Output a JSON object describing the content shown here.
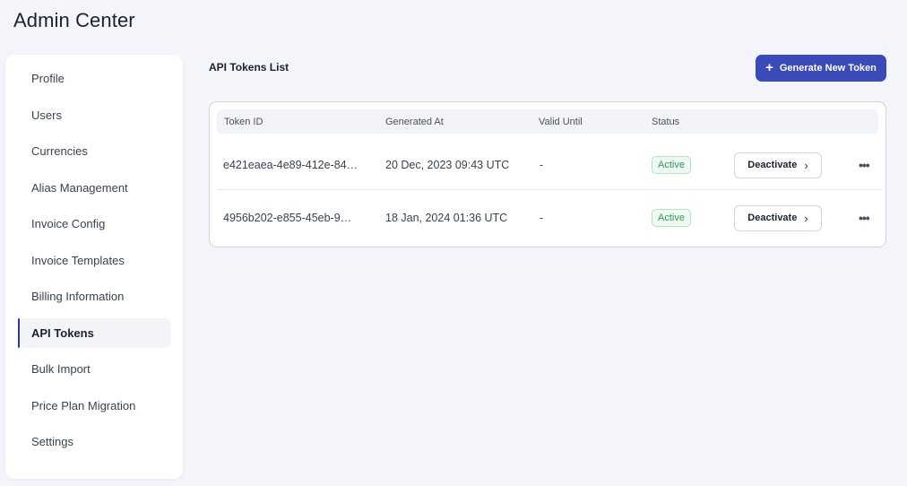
{
  "app": {
    "title": "Admin Center"
  },
  "sidebar": {
    "items": [
      {
        "label": "Profile"
      },
      {
        "label": "Users"
      },
      {
        "label": "Currencies"
      },
      {
        "label": "Alias Management"
      },
      {
        "label": "Invoice Config"
      },
      {
        "label": "Invoice Templates"
      },
      {
        "label": "Billing Information"
      },
      {
        "label": "API Tokens",
        "active": true
      },
      {
        "label": "Bulk Import"
      },
      {
        "label": "Price Plan Migration"
      },
      {
        "label": "Settings"
      }
    ]
  },
  "main": {
    "section_title": "API Tokens List",
    "generate_button": {
      "icon": "plus-icon",
      "label": "Generate New Token"
    },
    "table": {
      "headers": [
        "Token ID",
        "Generated At",
        "Valid Until",
        "Status"
      ],
      "rows": [
        {
          "token_id": "e421eaea-4e89-412e-84…",
          "generated_at": "20 Dec, 2023 09:43 UTC",
          "valid_until": "-",
          "status": "Active",
          "action_label": "Deactivate"
        },
        {
          "token_id": "4956b202-e855-45eb-9…",
          "generated_at": "18 Jan, 2024 01:36 UTC",
          "valid_until": "-",
          "status": "Active",
          "action_label": "Deactivate"
        }
      ]
    }
  },
  "colors": {
    "accent": "#3a4ab8",
    "active_indicator": "#2f3a9e",
    "status_active": "#2f9a5a",
    "background": "#f3f5fa"
  }
}
